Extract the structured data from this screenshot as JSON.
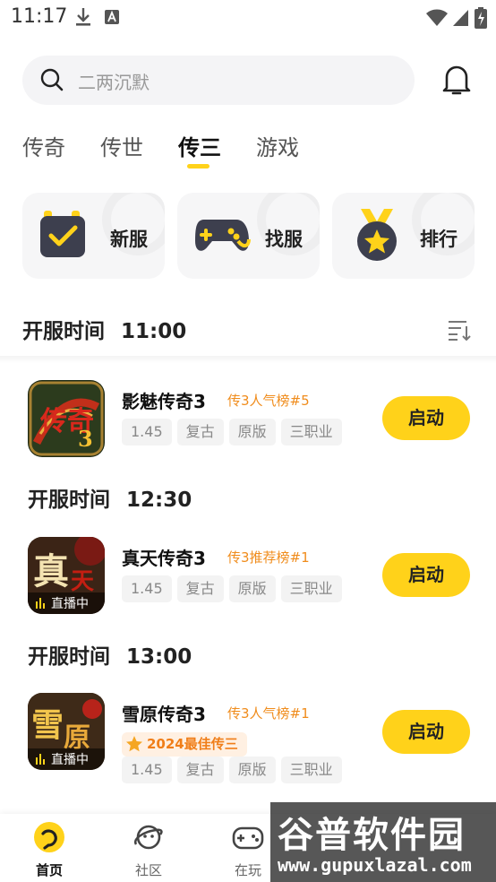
{
  "status_bar": {
    "time": "11:17"
  },
  "search": {
    "placeholder": "二两沉默"
  },
  "tabs": [
    {
      "label": "传奇"
    },
    {
      "label": "传世"
    },
    {
      "label": "传三"
    },
    {
      "label": "游戏"
    }
  ],
  "active_tab": "传三",
  "shortcuts": [
    {
      "label": "新服",
      "icon": "calendar-check-icon"
    },
    {
      "label": "找服",
      "icon": "gamepad-icon"
    },
    {
      "label": "排行",
      "icon": "medal-star-icon"
    }
  ],
  "section_header": {
    "label": "开服时间",
    "time": "11:00"
  },
  "games": [
    {
      "title": "影魅传奇3",
      "rank": "传3人气榜#5",
      "tags": [
        "1.45",
        "复古",
        "原版",
        "三职业"
      ],
      "action": "启动",
      "live": null,
      "award": null
    },
    {
      "time_label": "开服时间",
      "time": "12:30",
      "title": "真天传奇3",
      "rank": "传3推荐榜#1",
      "tags": [
        "1.45",
        "复古",
        "原版",
        "三职业"
      ],
      "action": "启动",
      "live": "直播中",
      "award": null
    },
    {
      "time_label": "开服时间",
      "time": "13:00",
      "title": "雪原传奇3",
      "rank": "传3人气榜#1",
      "tags": [
        "1.45",
        "复古",
        "原版",
        "三职业"
      ],
      "action": "启动",
      "live": "直播中",
      "award": "2024最佳传三"
    }
  ],
  "bottom_nav": [
    {
      "label": "首页",
      "icon": "home-icon"
    },
    {
      "label": "社区",
      "icon": "planet-icon"
    },
    {
      "label": "在玩",
      "icon": "gamepad-icon"
    }
  ],
  "watermark": {
    "title": "谷普软件园",
    "url": "www.gupuxlazal.com"
  },
  "colors": {
    "accent": "#ffd21a",
    "rank": "#f08c1c",
    "award_bg": "#fff0e2"
  }
}
